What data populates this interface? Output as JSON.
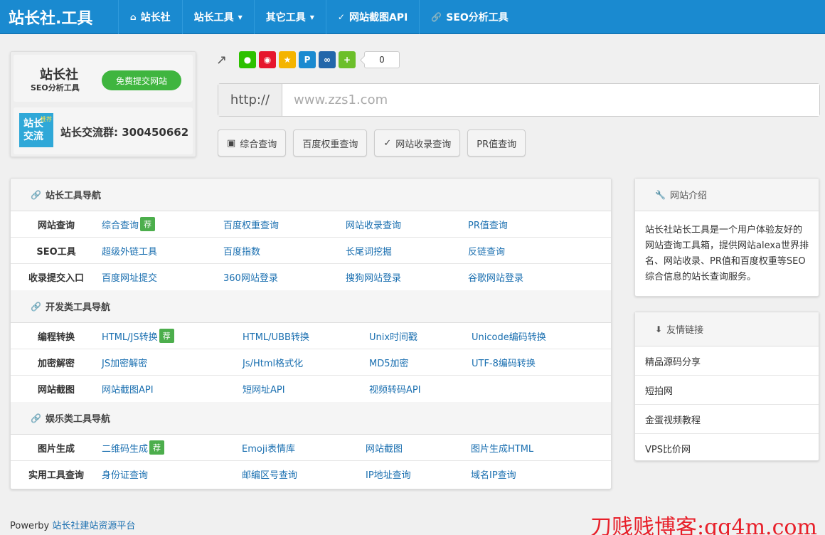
{
  "nav": {
    "brand": "站长社.工具",
    "items": [
      {
        "icon": "home-icon",
        "label": "站长社",
        "caret": false
      },
      {
        "icon": "",
        "label": "站长工具",
        "caret": true
      },
      {
        "icon": "",
        "label": "其它工具",
        "caret": true
      },
      {
        "icon": "download-icon",
        "label": "网站截图API",
        "caret": false
      },
      {
        "icon": "link-icon",
        "label": "SEO分析工具",
        "caret": false
      }
    ]
  },
  "logo": {
    "name": "站长社",
    "subtitle": "SEO分析工具",
    "submit_label": "免费提交网站",
    "qq_logo_text": "站长交流",
    "qq_logo_tag": "推荐",
    "qq_group": "站长交流群: 300450662"
  },
  "share": {
    "count": "0",
    "colors": {
      "wechat": "#2dc100",
      "weibo": "#e6162d",
      "qzone": "#f4b400",
      "tqq": "#1a8ad0",
      "renren": "#2266aa",
      "more": "#6cbf2a"
    }
  },
  "search": {
    "prefix": "http://",
    "placeholder": "www.zzs1.com",
    "buttons": [
      "综合查询",
      "百度权重查询",
      "网站收录查询",
      "PR值查询"
    ]
  },
  "sections": [
    {
      "title": "站长工具导航",
      "rows": [
        {
          "label": "网站查询",
          "links": [
            "综合查询",
            "百度权重查询",
            "网站收录查询",
            "PR值查询"
          ],
          "badge": "荐"
        },
        {
          "label": "SEO工具",
          "links": [
            "超级外链工具",
            "百度指数",
            "长尾词挖掘",
            "反链查询"
          ]
        },
        {
          "label": "收录提交入口",
          "links": [
            "百度网址提交",
            "360网站登录",
            "搜狗网站登录",
            "谷歌网站登录"
          ]
        }
      ]
    },
    {
      "title": "开发类工具导航",
      "rows": [
        {
          "label": "编程转换",
          "links": [
            "HTML/JS转换",
            "HTML/UBB转换",
            "Unix时间戳",
            "Unicode编码转换"
          ],
          "badge": "荐"
        },
        {
          "label": "加密解密",
          "links": [
            "JS加密解密",
            "Js/Html格式化",
            "MD5加密",
            "UTF-8编码转换"
          ]
        },
        {
          "label": "网站截图",
          "links": [
            "网站截图API",
            "短网址API",
            "视频转码API",
            ""
          ]
        }
      ]
    },
    {
      "title": "娱乐类工具导航",
      "rows": [
        {
          "label": "图片生成",
          "links": [
            "二维码生成",
            "Emoji表情库",
            "网站截图",
            "图片生成HTML"
          ],
          "badge": "荐"
        },
        {
          "label": "实用工具查询",
          "links": [
            "身份证查询",
            "邮编区号查询",
            "IP地址查询",
            "域名IP查询"
          ]
        }
      ]
    }
  ],
  "sidebar": {
    "intro_title": "网站介绍",
    "intro_text": "站长社站长工具是一个用户体验友好的网站查询工具箱，提供网站alexa世界排名、网站收录、PR值和百度权重等SEO综合信息的站长查询服务。",
    "links_title": "友情链接",
    "links": [
      "精品源码分享",
      "短拍网",
      "金蛋视频教程",
      "VPS比价网"
    ]
  },
  "footer": {
    "prefix": "Powerby",
    "link": "站长社建站资源平台"
  },
  "watermark": "刀贱贱博客:qq4m.com"
}
